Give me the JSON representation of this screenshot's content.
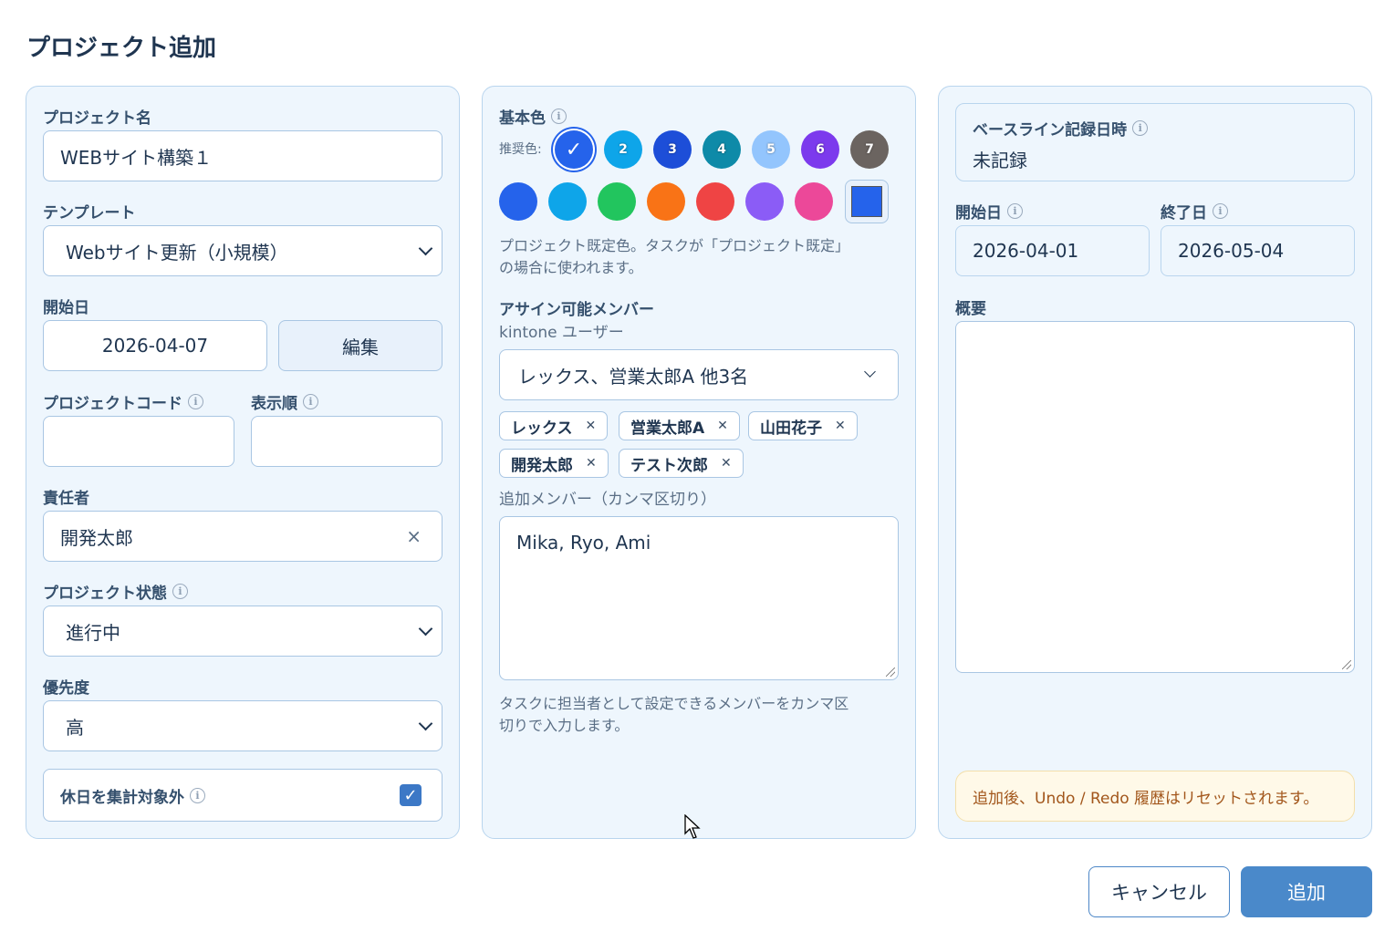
{
  "dialog": {
    "title": "プロジェクト追加"
  },
  "left": {
    "name_label": "プロジェクト名",
    "name_value": "WEBサイト構築１",
    "template_label": "テンプレート",
    "template_value": "Webサイト更新（小規模）",
    "start_label": "開始日",
    "start_value": "2026-04-07",
    "edit_label": "編集",
    "code_label": "プロジェクトコード",
    "code_value": "",
    "order_label": "表示順",
    "order_value": "",
    "owner_label": "責任者",
    "owner_value": "開発太郎",
    "status_label": "プロジェクト状態",
    "status_value": "進行中",
    "priority_label": "優先度",
    "priority_value": "高",
    "holiday_label": "休日を集計対象外",
    "holiday_checked": true
  },
  "middle": {
    "color_label": "基本色",
    "recommended_label": "推奨色:",
    "recommended": [
      {
        "label": "✓",
        "color": "#2563eb",
        "selected": true
      },
      {
        "label": "2",
        "color": "#0ea5e9"
      },
      {
        "label": "3",
        "color": "#1d4ed8"
      },
      {
        "label": "4",
        "color": "#0e8aa8"
      },
      {
        "label": "5",
        "color": "#93c5fd"
      },
      {
        "label": "6",
        "color": "#7c3aed"
      },
      {
        "label": "7",
        "color": "#6b6460"
      }
    ],
    "palette": [
      "#2563eb",
      "#0ea5e9",
      "#22c55e",
      "#f97316",
      "#ef4444",
      "#8b5cf6",
      "#ec4899"
    ],
    "custom_color": "#2563eb",
    "color_help_1": "プロジェクト既定色。タスクが「プロジェクト既定」",
    "color_help_2": "の場合に使われます。",
    "members_label": "アサイン可能メンバー",
    "kintone_label": "kintone ユーザー",
    "members_select": "レックス、営業太郎A 他3名",
    "chips": [
      "レックス",
      "営業太郎A",
      "山田花子",
      "開発太郎",
      "テスト次郎"
    ],
    "extra_label": "追加メンバー（カンマ区切り）",
    "extra_value": "Mika, Ryo, Ami",
    "extra_help_1": "タスクに担当者として設定できるメンバーをカンマ区",
    "extra_help_2": "切りで入力します。"
  },
  "right": {
    "baseline_label": "ベースライン記録日時",
    "baseline_value": "未記録",
    "start_label": "開始日",
    "start_value": "2026-04-01",
    "end_label": "終了日",
    "end_value": "2026-05-04",
    "summary_label": "概要",
    "summary_value": "",
    "notice": "追加後、Undo / Redo 履歴はリセットされます。"
  },
  "footer": {
    "cancel_label": "キャンセル",
    "add_label": "追加"
  }
}
